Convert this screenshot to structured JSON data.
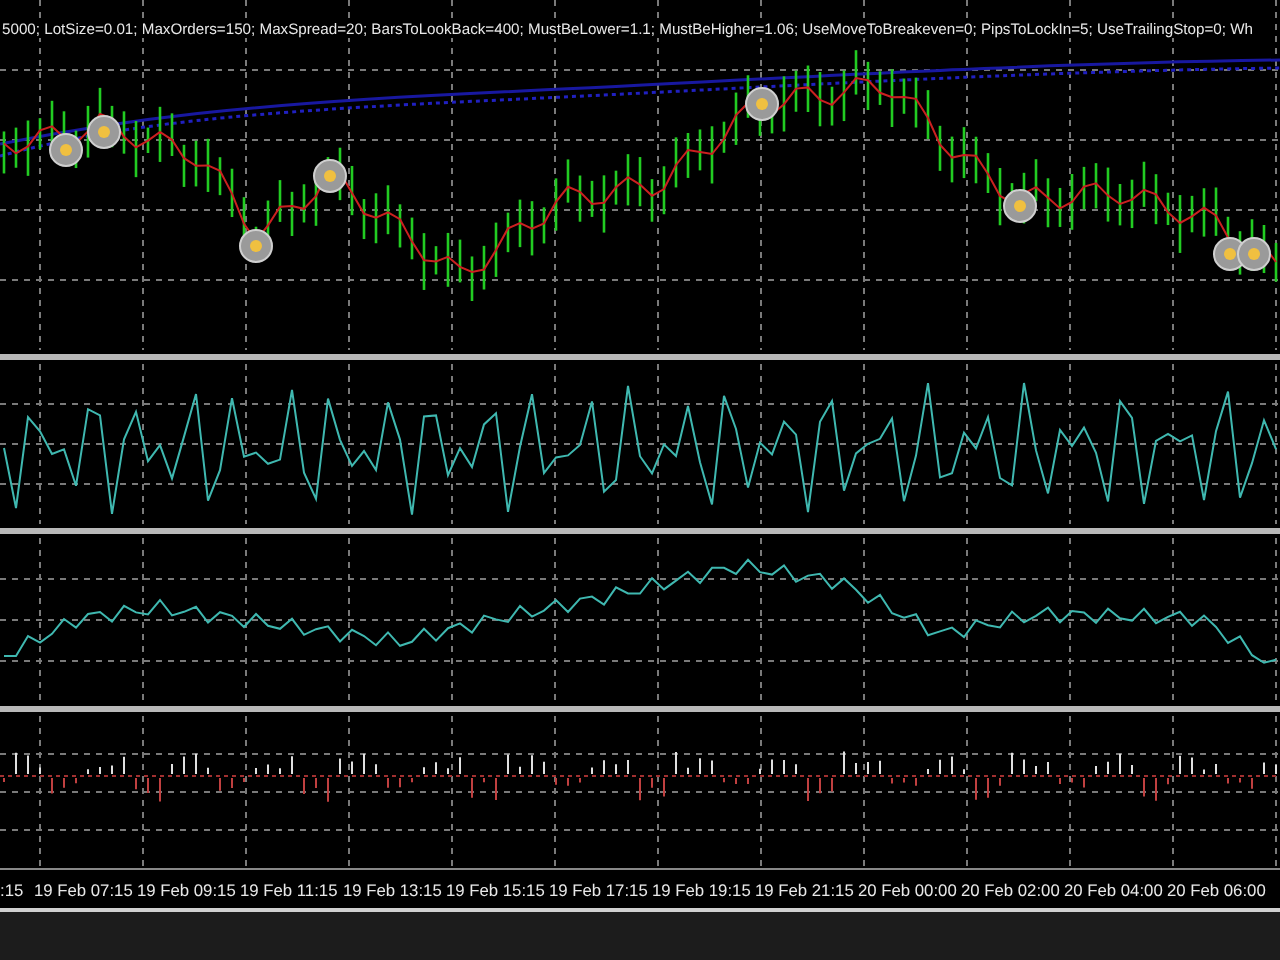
{
  "chart": {
    "parameters_text": "5000; LotSize=0.01; MaxOrders=150; MaxSpread=20; BarsToLookBack=400; MustBeLower=1.1; MustBeHigher=1.06; UseMoveToBreakeven=0; PipsToLockIn=5; UseTrailingStop=0; Wh",
    "time_labels": [
      ":15",
      "19 Feb 07:15",
      "19 Feb 09:15",
      "19 Feb 11:15",
      "19 Feb 13:15",
      "19 Feb 15:15",
      "19 Feb 17:15",
      "19 Feb 19:15",
      "19 Feb 21:15",
      "20 Feb 00:00",
      "20 Feb 02:00",
      "20 Feb 04:00",
      "20 Feb 06:00"
    ]
  }
}
